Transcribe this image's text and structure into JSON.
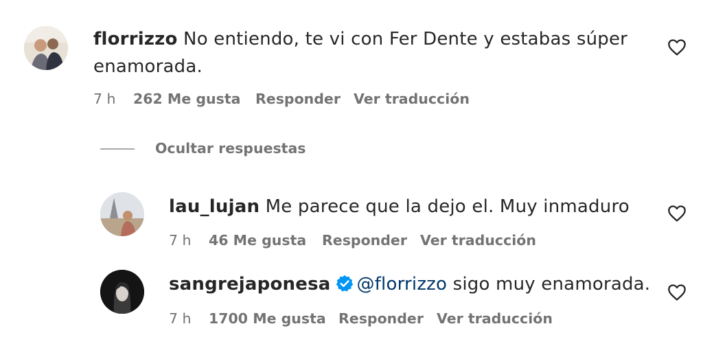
{
  "comments": [
    {
      "username": "florrizzo",
      "text_line1": "No entiendo, te vi con Fer Dente y estabas súper",
      "text_line2": "enamorada.",
      "time": "7 h",
      "likes": "262 Me gusta",
      "reply_label": "Responder",
      "translate_label": "Ver traducción"
    }
  ],
  "replies_toggle": {
    "label": "Ocultar respuestas"
  },
  "replies": [
    {
      "username": "lau_lujan",
      "text": "Me parece que la dejo el. Muy inmaduro",
      "time": "7 h",
      "likes": "46 Me gusta",
      "reply_label": "Responder",
      "translate_label": "Ver traducción"
    },
    {
      "username": "sangrejaponesa",
      "verified": true,
      "mention": "@florrizzo",
      "text": "sigo muy enamorada.",
      "time": "7 h",
      "likes": "1700 Me gusta",
      "reply_label": "Responder",
      "translate_label": "Ver traducción"
    }
  ],
  "colors": {
    "primary_text": "#262626",
    "secondary_text": "#737373",
    "mention": "#00376b",
    "verified_badge": "#0095f6"
  },
  "icons": [
    "heart-icon",
    "verified-badge-icon"
  ]
}
